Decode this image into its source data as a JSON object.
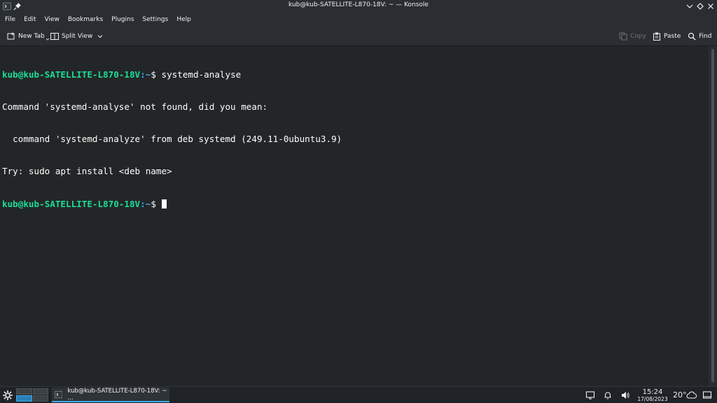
{
  "window": {
    "title": "kub@kub-SATELLITE-L870-18V: ~ — Konsole"
  },
  "menu": [
    "File",
    "Edit",
    "View",
    "Bookmarks",
    "Plugins",
    "Settings",
    "Help"
  ],
  "toolbar": {
    "new_tab": "New Tab",
    "split_view": "Split View",
    "copy": "Copy",
    "paste": "Paste",
    "find": "Find"
  },
  "terminal": {
    "prompt_user": "kub@kub-SATELLITE-L870-18V",
    "prompt_sep": ":",
    "prompt_path": "~",
    "prompt_symbol": "$ ",
    "command": "systemd-analyse",
    "output": [
      "Command 'systemd-analyse' not found, did you mean:",
      "  command 'systemd-analyze' from deb systemd (249.11-0ubuntu3.9)",
      "Try: sudo apt install <deb name>"
    ]
  },
  "taskbar": {
    "task_label": "kub@kub-SATELLITE-L870-18V: ~ ...",
    "time": "15:24",
    "date": "17/08/2023",
    "temperature": "20°"
  },
  "colors": {
    "prompt_user": "#1cdc9a",
    "prompt_path": "#3daee9",
    "accent": "#3daee9"
  }
}
